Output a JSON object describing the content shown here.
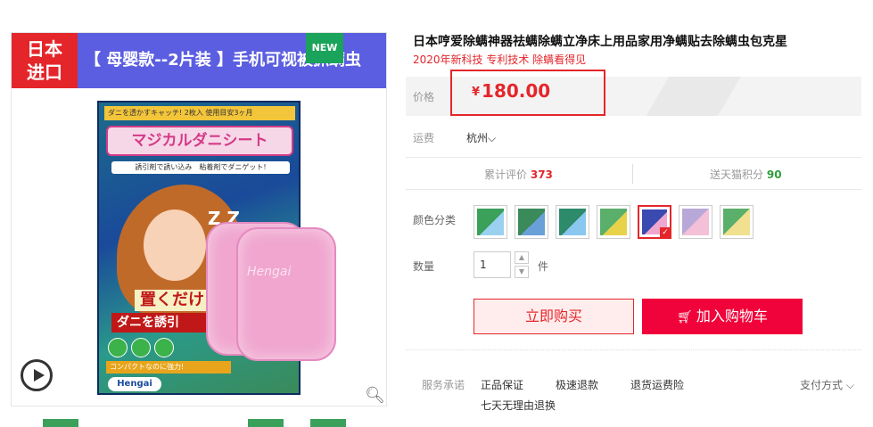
{
  "gallery": {
    "import_tag": "日本\n进口",
    "import_line1": "日本",
    "import_line2": "进口",
    "banner_text": "【 母婴款--2片装 】手机可视被抓螨虫",
    "new_badge": "NEW",
    "box_title": "マジカルダニシート",
    "box_sub": "誘引剤で誘い込み　粘着剤でダニゲット!",
    "box_top": "ダニを透かすキャッチ!  2枚入  使用目安3ヶ月",
    "box_band1": "置くだけ",
    "box_band2": "ダニを誘引",
    "box_strip": "コンパクトなのに強力!",
    "box_logo": "Hengai",
    "pad_text": "Hengai",
    "zz": "Z Z"
  },
  "product": {
    "title": "日本哼爱除螨神器祛螨除螨立净床上用品家用净螨贴去除螨虫包克星",
    "subtitle": "2020年新科技 专利技术 除螨看得见"
  },
  "price": {
    "label": "价格",
    "currency": "¥",
    "value": "180.00"
  },
  "shipping": {
    "label": "运费",
    "location": "杭州"
  },
  "stats": {
    "reviews_label": "累计评价",
    "reviews_count": "373",
    "points_label": "送天猫积分",
    "points_value": "90"
  },
  "color": {
    "label": "颜色分类",
    "selected_index": 4,
    "swatch_colors": [
      "#3aa05a",
      "#6aa0d8",
      "#2d8a6a",
      "#e8d24a",
      "#3a4ab0",
      "#b8a8d8",
      "#5ab06a"
    ]
  },
  "quantity": {
    "label": "数量",
    "value": "1",
    "unit": "件"
  },
  "actions": {
    "buy_now": "立即购买",
    "add_to_cart": "加入购物车"
  },
  "services": {
    "label": "服务承诺",
    "items": [
      "正品保证",
      "极速退款",
      "退货运费险",
      "七天无理由退换"
    ],
    "payment_label": "支付方式"
  },
  "colors": {
    "brand_red": "#e4262b",
    "cart_red": "#f0023a",
    "banner_blue": "#5b5ee0",
    "badge_green": "#1aa35a"
  }
}
